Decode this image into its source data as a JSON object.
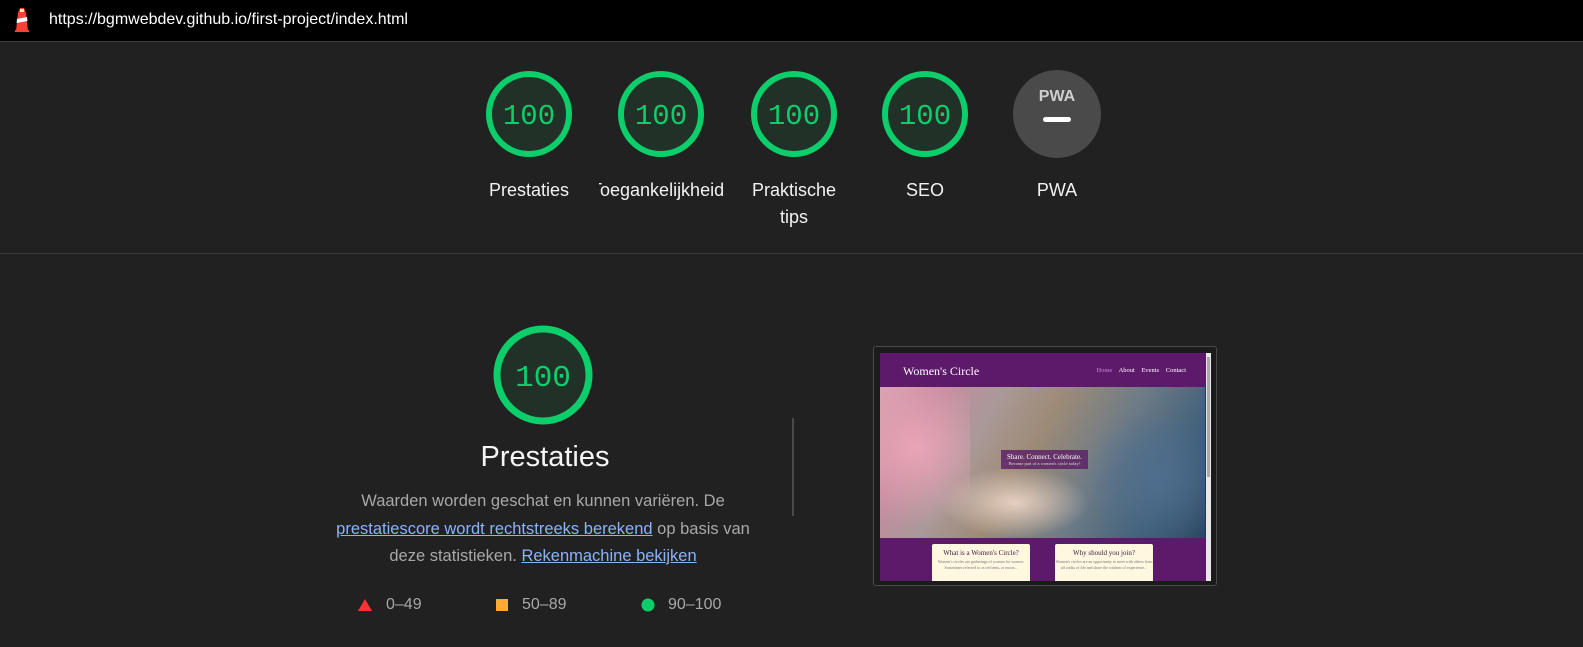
{
  "topbar": {
    "url": "https://bgmwebdev.github.io/first-project/index.html",
    "logo_icon": "lighthouse-icon"
  },
  "gauges": [
    {
      "score": "100",
      "label": "Prestaties",
      "status": "pass"
    },
    {
      "score": "100",
      "label": "Toegankelijkheid",
      "status": "pass"
    },
    {
      "score": "100",
      "label": "Praktische tips",
      "status": "pass"
    },
    {
      "score": "100",
      "label": "SEO",
      "status": "pass"
    },
    {
      "score": "—",
      "label": "PWA",
      "badge": "PWA",
      "status": "neutral"
    }
  ],
  "category": {
    "score": "100",
    "title": "Prestaties",
    "desc_part1": "Waarden worden geschat en kunnen variëren. De ",
    "desc_link1": "prestatiescore wordt rechtstreeks berekend",
    "desc_part2": " op basis van deze statistieken. ",
    "desc_link2": "Rekenmachine bekijken"
  },
  "legend": [
    {
      "range": "0–49",
      "icon": "triangle-icon",
      "color": "#ff3333"
    },
    {
      "range": "50–89",
      "icon": "square-icon",
      "color": "#ffaa33"
    },
    {
      "range": "90–100",
      "icon": "circle-icon",
      "color": "#0cce6b"
    }
  ],
  "screenshot": {
    "brand": "Women's Circle",
    "nav": [
      "Home",
      "About",
      "Events",
      "Contact"
    ],
    "hero_caption": "Share. Connect. Celebrate.",
    "hero_sub": "Become part of a women's circle today!",
    "cards": [
      {
        "title": "What is a Women's Circle?",
        "text": "Women's circles are gatherings of women for women. Sometimes referred to as red tents, or moon..."
      },
      {
        "title": "Why should you join?",
        "text": "Women's circles are an opportunity to meet with others from all walks of life and share the wisdom of experience..."
      }
    ]
  },
  "colors": {
    "pass": "#0cce6b",
    "pass_fill": "#213127",
    "neutral": "#4a4a4a",
    "link": "#8ab4f8",
    "background": "#212121"
  }
}
